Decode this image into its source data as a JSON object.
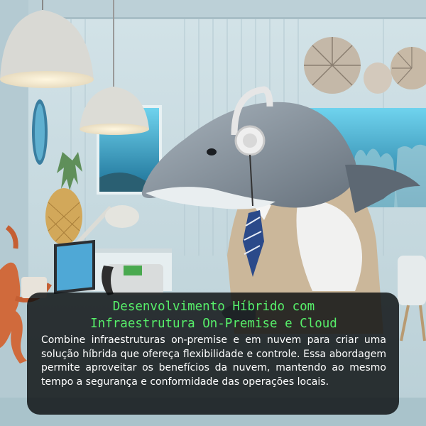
{
  "caption": {
    "title_line1": "Desenvolvimento Híbrido com",
    "title_line2": "Infraestrutura On-Premise e Cloud",
    "body": "Combine infraestruturas on-premise e em nuvem para criar uma solução híbrida que ofereça flexibilidade e controle. Essa abordagem permite aproveitar os benefícios da nuvem, mantendo ao mesmo tempo a segurança e conformidade das operações locais."
  },
  "colors": {
    "title": "#57f06a",
    "body_text": "#ffffff",
    "caption_background": "#0a0e10",
    "wall": "#c9dce3",
    "dolphin": "#8f9ba6",
    "vest": "#cbb79a"
  }
}
